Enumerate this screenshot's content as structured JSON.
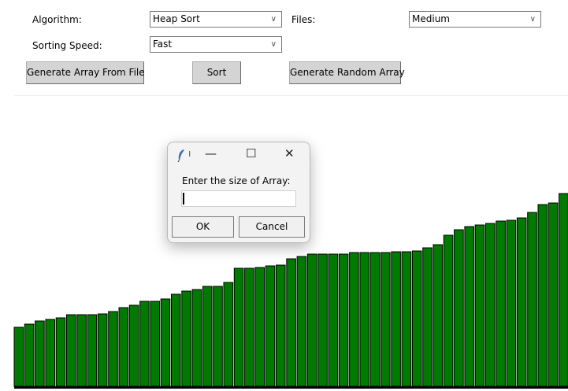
{
  "controls": {
    "algorithm_label": "Algorithm:",
    "algorithm_value": "Heap Sort",
    "files_label": "Files:",
    "files_value": "Medium",
    "speed_label": "Sorting Speed:",
    "speed_value": "Fast",
    "gen_file_button": "Generate Array From File",
    "sort_button": "Sort",
    "gen_random_button": "Generate Random Array"
  },
  "dialog": {
    "title": "ı",
    "minimize": "—",
    "maximize": "☐",
    "close": "✕",
    "prompt": "Enter the size of Array:",
    "input_value": "",
    "ok_label": "OK",
    "cancel_label": "Cancel"
  },
  "colors": {
    "bar_fill": "#007a00",
    "bar_stroke": "#000000"
  },
  "bars": [
    75,
    79,
    83,
    85,
    87,
    91,
    91,
    91,
    92,
    95,
    100,
    103,
    108,
    108,
    111,
    117,
    121,
    123,
    127,
    127,
    132,
    150,
    150,
    151,
    153,
    154,
    162,
    165,
    168,
    168,
    168,
    168,
    170,
    170,
    170,
    170,
    171,
    171,
    172,
    176,
    180,
    192,
    199,
    203,
    205,
    207,
    210,
    211,
    214,
    221,
    231,
    233,
    245,
    248,
    250,
    250,
    252
  ]
}
